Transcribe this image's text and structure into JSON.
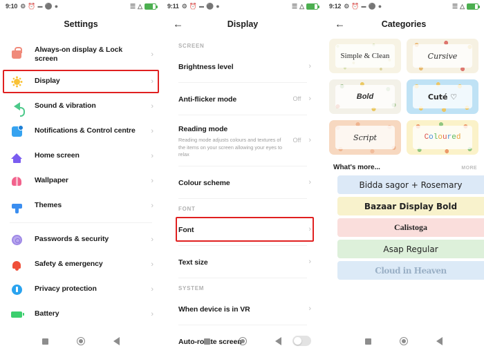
{
  "panels": {
    "settings": {
      "status": {
        "time": "9:10",
        "icons": [
          "alarm-icon",
          "clock-icon",
          "dnd-icon",
          "shield-icon",
          "gear-icon"
        ],
        "signal": "signal-icon",
        "wifi": "wifi-icon",
        "battery": "battery-icon"
      },
      "title": "Settings",
      "items_group1": [
        {
          "label": "Always-on display & Lock screen",
          "icon": "lock-icon",
          "highlight": false
        },
        {
          "label": "Display",
          "icon": "brightness-icon",
          "highlight": true
        },
        {
          "label": "Sound & vibration",
          "icon": "speaker-icon",
          "highlight": false
        },
        {
          "label": "Notifications & Control centre",
          "icon": "notification-icon",
          "highlight": false
        },
        {
          "label": "Home screen",
          "icon": "home-icon",
          "highlight": false
        },
        {
          "label": "Wallpaper",
          "icon": "wallpaper-icon",
          "highlight": false
        },
        {
          "label": "Themes",
          "icon": "themes-icon",
          "highlight": false
        }
      ],
      "items_group2": [
        {
          "label": "Passwords & security",
          "icon": "fingerprint-icon",
          "highlight": false
        },
        {
          "label": "Safety & emergency",
          "icon": "bell-icon",
          "highlight": false
        },
        {
          "label": "Privacy protection",
          "icon": "shield-icon",
          "highlight": false
        },
        {
          "label": "Battery",
          "icon": "battery-icon",
          "highlight": false
        }
      ]
    },
    "display": {
      "status": {
        "time": "9:11"
      },
      "title": "Display",
      "back": "back-arrow-icon",
      "section_screen": "SCREEN",
      "section_font": "FONT",
      "section_system": "SYSTEM",
      "rows_screen": [
        {
          "title": "Brightness level",
          "desc": "",
          "value": ""
        },
        {
          "title": "Anti-flicker mode",
          "desc": "",
          "value": "Off"
        },
        {
          "title": "Reading mode",
          "desc": "Reading mode adjusts colours and textures of the items on your screen allowing your eyes to relax",
          "value": "Off"
        },
        {
          "title": "Colour scheme",
          "desc": "",
          "value": ""
        }
      ],
      "rows_font": [
        {
          "title": "Font",
          "desc": "",
          "value": "",
          "highlight": true
        },
        {
          "title": "Text size",
          "desc": "",
          "value": "",
          "highlight": false
        }
      ],
      "rows_system": [
        {
          "title": "When device is in VR",
          "desc": "",
          "value": "",
          "toggle": false
        },
        {
          "title": "Auto-rotate screen",
          "desc": "",
          "value": "",
          "toggle": true,
          "toggle_on": false
        }
      ]
    },
    "categories": {
      "status": {
        "time": "9:12"
      },
      "title": "Categories",
      "back": "back-arrow-icon",
      "cards": [
        {
          "name": "Simple & Clean",
          "bg": "#f7f3e4",
          "style": "f-serif"
        },
        {
          "name": "Cursive",
          "bg": "#f6f1e2",
          "style": "f-script"
        },
        {
          "name": "Bold",
          "bg": "#f4f2ea",
          "style": "f-bold"
        },
        {
          "name": "Cuté ♡",
          "bg": "#cfe8f7",
          "style": "f-dejavu"
        },
        {
          "name": "Script",
          "bg": "#f9ddc8",
          "style": "f-script"
        },
        {
          "name": "Coloured",
          "bg": "#fbf3cf",
          "style": "f-mono"
        }
      ],
      "whats_more": "What's more...",
      "more_link": "MORE",
      "font_rows": [
        {
          "name": "Bidda sagor + Rosemary",
          "bg": "#dce9f7",
          "style": "f-dejavu"
        },
        {
          "name": "Bazaar Display Bold",
          "bg": "#f8f2cc",
          "style": "f-dejavu"
        },
        {
          "name": "Calistoga",
          "bg": "#fadedc",
          "style": "f-serif"
        },
        {
          "name": "Asap Regular",
          "bg": "#ddf0da",
          "style": "f-dejavu"
        },
        {
          "name": "Cloud in Heaven",
          "bg": "#dceaf7",
          "style": "f-gothic"
        }
      ]
    }
  },
  "navbar": {
    "recents": "recents-square-icon",
    "home": "home-circle-icon",
    "back": "back-triangle-icon"
  },
  "colors": {
    "highlight": "#e02020",
    "accent_green": "#4caf50"
  }
}
